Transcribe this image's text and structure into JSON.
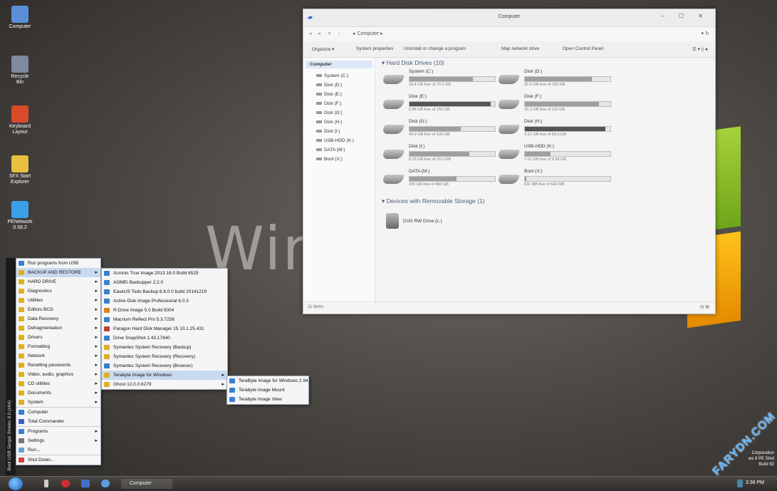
{
  "desktop": {
    "background_text": "Win",
    "icons": [
      {
        "label": "Computer",
        "color": "#5a8fd8"
      },
      {
        "label": "Recycle Bin",
        "color": "#7d8aa0"
      },
      {
        "label": "Keyboard Layout",
        "color": "#d94a2a"
      },
      {
        "label": "SFX Start Explorer",
        "color": "#e8c040"
      },
      {
        "label": "PENetwork 0.58.2",
        "color": "#3aa0e8"
      }
    ],
    "corner_lines": [
      "Corporation",
      "ws 8 PE Strel",
      "Build 92"
    ],
    "watermark": "FARYDN.COM"
  },
  "explorer": {
    "title": "Computer",
    "window_controls": "– ☐ ✕",
    "address": {
      "nav": "◂ ▸ ▾ ↑",
      "path": "▸ Computer ▸",
      "right": "▾ ↻"
    },
    "toolbar": [
      "Organize ▾",
      "System properties",
      "Uninstall or change a program",
      "Map network drive",
      "Open Control Panel"
    ],
    "nav_header": "Computer",
    "nav_items": [
      "System (C:)",
      "Disk (D:)",
      "Disk (E:)",
      "Disk (F:)",
      "Disk (G:)",
      "Disk (H:)",
      "Disk (I:)",
      "USB-HDD (K:)",
      "DATA (M:)",
      "Boot (X:)"
    ],
    "hard_disk_header": "Hard Disk Drives (10)",
    "drives": [
      {
        "name": "System (C:)",
        "free": "18.4 GB free of 70.2 GB",
        "used_fraction": 0.74
      },
      {
        "name": "Disk (D:)",
        "free": "32.9 GB free of 150 GB",
        "used_fraction": 0.78
      },
      {
        "name": "Disk (E:)",
        "free": "6.86 GB free of 150 GB",
        "used_fraction": 0.95
      },
      {
        "name": "Disk (F:)",
        "free": "15.3 GB free of 115 GB",
        "used_fraction": 0.87
      },
      {
        "name": "Disk (G:)",
        "free": "40.0 GB free of 100 GB",
        "used_fraction": 0.6
      },
      {
        "name": "Disk (H:)",
        "free": "3.61 GB free of 60.0 GB",
        "used_fraction": 0.94
      },
      {
        "name": "Disk (I:)",
        "free": "6.03 GB free of 20.0 GB",
        "used_fraction": 0.7
      },
      {
        "name": "USB-HDD (K:)",
        "free": "7.01 GB free of 9.98 GB",
        "used_fraction": 0.3
      },
      {
        "name": "DATA (M:)",
        "free": "200 GB free of 450 GB",
        "used_fraction": 0.55
      },
      {
        "name": "Boot (X:)",
        "free": "631 MB free of 642 MB",
        "used_fraction": 0.02
      }
    ],
    "removable_header": "Devices with Removable Storage (1)",
    "dvd": "DVD RW Drive (L:)",
    "status": "11 items"
  },
  "start_menu": {
    "side_label": "Boot USB Sergei Strelec 8.0 (x64)",
    "items": [
      {
        "label": "Run programs from USB",
        "color": "#3a7fd0",
        "sub": false
      },
      {
        "label": "BACKUP AND RESTORE",
        "color": "#e0b020",
        "sub": true
      },
      {
        "label": "HARD DRIVE",
        "color": "#e0b020",
        "sub": true
      },
      {
        "label": "Diagnostics",
        "color": "#e0b020",
        "sub": true
      },
      {
        "label": "Utilities",
        "color": "#e0b020",
        "sub": true
      },
      {
        "label": "Editors BCD",
        "color": "#e0b020",
        "sub": true
      },
      {
        "label": "Data Recovery",
        "color": "#e0b020",
        "sub": true
      },
      {
        "label": "Defragmentation",
        "color": "#e0b020",
        "sub": true
      },
      {
        "label": "Drivers",
        "color": "#e0b020",
        "sub": true
      },
      {
        "label": "Formatting",
        "color": "#e0b020",
        "sub": true
      },
      {
        "label": "Network",
        "color": "#e0b020",
        "sub": true
      },
      {
        "label": "Resetting passwords",
        "color": "#e0b020",
        "sub": true
      },
      {
        "label": "Video, audio, graphics",
        "color": "#e0b020",
        "sub": true
      },
      {
        "label": "CD utilities",
        "color": "#e0b020",
        "sub": true
      },
      {
        "label": "Documents",
        "color": "#e0b020",
        "sub": true
      },
      {
        "label": "System",
        "color": "#e0b020",
        "sub": true
      },
      {
        "label": "Computer",
        "color": "#3a7fd0",
        "sub": false
      },
      {
        "label": "Total Commander",
        "color": "#3a5fc0",
        "sub": false
      },
      {
        "label": "Programs",
        "color": "#3a7fd0",
        "sub": true
      },
      {
        "label": "Settings",
        "color": "#777777",
        "sub": true
      },
      {
        "label": "Run...",
        "color": "#6aa0d8",
        "sub": false
      },
      {
        "label": "Shut Down...",
        "color": "#d04040",
        "sub": false
      }
    ],
    "backup_submenu": [
      {
        "label": "Acronis True Image 2013 18.0 Build 6525",
        "color": "#3a7fd0"
      },
      {
        "label": "AOMEI Backupper 2.2.0",
        "color": "#3a7fd0"
      },
      {
        "label": "EaseUS Todo Backup 8.8.0.0 build 20141219",
        "color": "#3a7fd0"
      },
      {
        "label": "Active Disk Image Professional 6.0.3",
        "color": "#3a7fd0"
      },
      {
        "label": "R-Drive Image 5.0 Build 5004",
        "color": "#e08020"
      },
      {
        "label": "Macrium Reflect Pro 5.3.7256",
        "color": "#3a7fd0"
      },
      {
        "label": "Paragon Hard Disk Manager 15 10.1.25.431",
        "color": "#c04030"
      },
      {
        "label": "Drive SnapShot 1.43.17440",
        "color": "#3a7fd0"
      },
      {
        "label": "Symantec System Recovery (Backup)",
        "color": "#e0b020"
      },
      {
        "label": "Symantec System Recovery (Recovery)",
        "color": "#e0b020"
      },
      {
        "label": "Symantec System Recovery (Browser)",
        "color": "#3a7fd0"
      },
      {
        "label": "Terabyte Image for Windows",
        "color": "#e0b020"
      },
      {
        "label": "Ghost 12.0.0.6279",
        "color": "#e0b020"
      }
    ],
    "terabyte_submenu": [
      {
        "label": "TeraByte Image for Windows 2.94",
        "color": "#3a7fd0"
      },
      {
        "label": "Terabyte Image Mount",
        "color": "#3a7fd0"
      },
      {
        "label": "Terabyte Image View",
        "color": "#3a7fd0"
      }
    ]
  },
  "taskbar": {
    "task_label": "Computer",
    "clock": "3:36 PM"
  }
}
